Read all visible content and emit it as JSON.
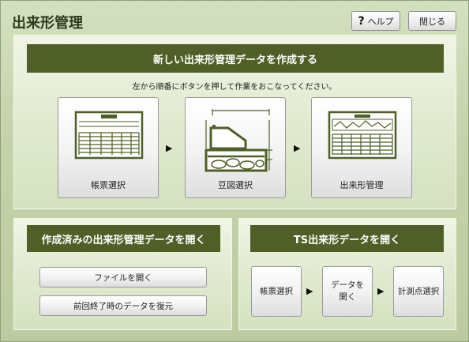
{
  "window": {
    "title": "出来形管理"
  },
  "toolbar": {
    "help_glyph": "?",
    "help_label": "ヘルプ",
    "close_label": "閉じる"
  },
  "create": {
    "banner": "新しい出来形管理データを作成する",
    "instruction": "左から順番にボタンを押して作業をおこなってください。",
    "steps": [
      {
        "label": "帳票選択",
        "icon": "form-sheet-icon"
      },
      {
        "label": "豆図選択",
        "icon": "cross-section-icon"
      },
      {
        "label": "出来形管理",
        "icon": "spreadsheet-chart-icon"
      }
    ],
    "arrow": "▶"
  },
  "open_existing": {
    "banner": "作成済みの出来形管理データを開く",
    "buttons": [
      "ファイルを開く",
      "前回終了時のデータを復元"
    ]
  },
  "ts": {
    "banner": "TS出来形データを開く",
    "buttons": [
      "帳票選択",
      "データを\n開く",
      "計測点選択"
    ],
    "arrow": "▶"
  },
  "colors": {
    "banner": "#4f5f27",
    "background": "#c4d3ac",
    "icon": "#4f5f27"
  }
}
